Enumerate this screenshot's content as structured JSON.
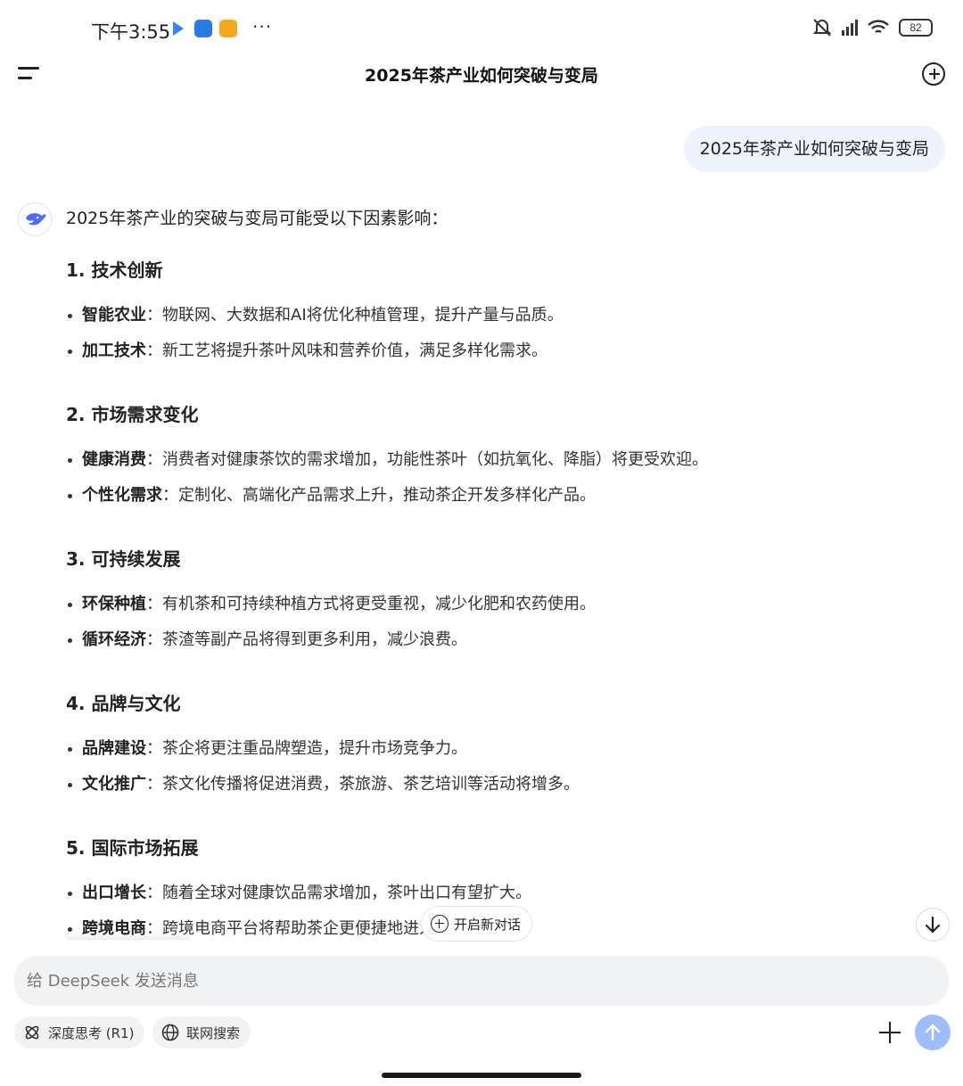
{
  "status_bar": {
    "time": "下午3:55",
    "more": "···",
    "battery": "82"
  },
  "header": {
    "title": "2025年茶产业如何突破与变局"
  },
  "user_message": "2025年茶产业如何突破与变局",
  "answer": {
    "intro": "2025年茶产业的突破与变局可能受以下因素影响：",
    "sections": [
      {
        "title": "1. 技术创新",
        "items": [
          {
            "term": "智能农业",
            "text": "物联网、大数据和AI将优化种植管理，提升产量与品质。"
          },
          {
            "term": "加工技术",
            "text": "新工艺将提升茶叶风味和营养价值，满足多样化需求。"
          }
        ]
      },
      {
        "title": "2. 市场需求变化",
        "items": [
          {
            "term": "健康消费",
            "text": "消费者对健康茶饮的需求增加，功能性茶叶（如抗氧化、降脂）将更受欢迎。"
          },
          {
            "term": "个性化需求",
            "text": "定制化、高端化产品需求上升，推动茶企开发多样化产品。"
          }
        ]
      },
      {
        "title": "3. 可持续发展",
        "items": [
          {
            "term": "环保种植",
            "text": "有机茶和可持续种植方式将更受重视，减少化肥和农药使用。"
          },
          {
            "term": "循环经济",
            "text": "茶渣等副产品将得到更多利用，减少浪费。"
          }
        ]
      },
      {
        "title": "4. 品牌与文化",
        "items": [
          {
            "term": "品牌建设",
            "text": "茶企将更注重品牌塑造，提升市场竞争力。"
          },
          {
            "term": "文化推广",
            "text": "茶文化传播将促进消费，茶旅游、茶艺培训等活动将增多。"
          }
        ]
      },
      {
        "title": "5. 国际市场拓展",
        "items": [
          {
            "term": "出口增长",
            "text": "随着全球对健康饮品需求增加，茶叶出口有望扩大。"
          },
          {
            "term": "跨境电商",
            "text": "跨境电商平台将帮助茶企更便捷地进入国际市场。"
          }
        ]
      }
    ],
    "colon": "："
  },
  "floating": {
    "new_chat_label": "开启新对话"
  },
  "composer": {
    "placeholder": "给 DeepSeek 发送消息",
    "deep_think_label": "深度思考 (R1)",
    "web_search_label": "联网搜索"
  },
  "colors": {
    "user_bubble": "#eef3fd",
    "send_button": "#9dbdfb",
    "input_bg": "#f2f3f5",
    "brand_blue": "#4d6bfe"
  }
}
